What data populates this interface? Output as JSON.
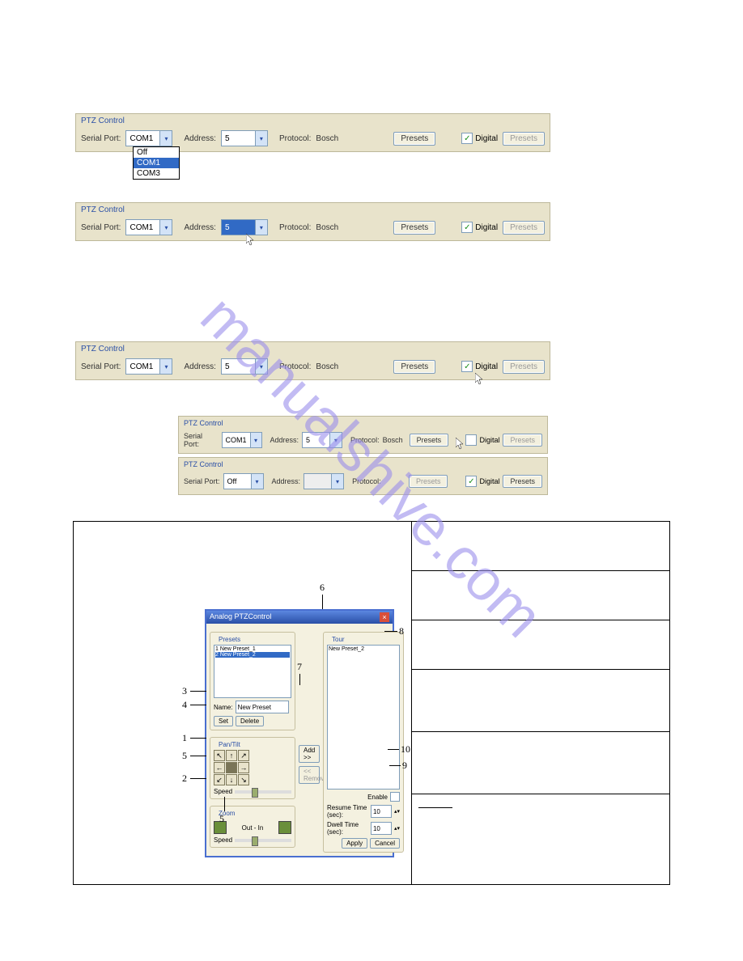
{
  "common": {
    "ptz_title": "PTZ Control",
    "serial_label": "Serial Port:",
    "address_label": "Address:",
    "protocol_label": "Protocol:",
    "presets_btn": "Presets",
    "digital_label": "Digital"
  },
  "bar1": {
    "serial_value": "COM1",
    "address_value": "5",
    "protocol_value": "Bosch",
    "digital_checked": "✓",
    "dropdown": {
      "opt0": "Off",
      "opt1": "COM1",
      "opt2": "COM3"
    }
  },
  "bar2": {
    "serial_value": "COM1",
    "address_value": "5",
    "protocol_value": "Bosch",
    "digital_checked": "✓"
  },
  "bar3": {
    "serial_value": "COM1",
    "address_value": "5",
    "protocol_value": "Bosch",
    "digital_checked": "✓"
  },
  "bar4": {
    "serial_value": "COM1",
    "address_value": "5",
    "protocol_value": "Bosch",
    "digital_checked": ""
  },
  "bar5": {
    "serial_value": "Off",
    "address_value": "",
    "protocol_value": "",
    "digital_checked": "✓"
  },
  "analog": {
    "title": "Analog PTZControl",
    "presets_title": "Presets",
    "preset1": "1    New Preset_1",
    "preset2": "2    New Preset_2",
    "name_label": "Name:",
    "name_value": "New Preset",
    "set_btn": "Set",
    "delete_btn": "Delete",
    "pantilt_title": "Pan/Tilt",
    "speed_label": "Speed",
    "zoom_title": "Zoom",
    "zoom_text": "Out - In",
    "add_btn": "Add >>",
    "remove_btn": "<< Remove",
    "tour_title": "Tour",
    "tour_item": "New Preset_2",
    "enable_label": "Enable",
    "resume_label": "Resume Time (sec):",
    "resume_value": "10",
    "dwell_label": "Dwell Time (sec):",
    "dwell_value": "10",
    "apply_btn": "Apply",
    "cancel_btn": "Cancel"
  },
  "callouts": {
    "n1": "1",
    "n2": "2",
    "n3": "3",
    "n4": "4",
    "n5": "5",
    "n6": "6",
    "n7": "7",
    "n8": "8",
    "n9": "9",
    "n10": "10"
  }
}
